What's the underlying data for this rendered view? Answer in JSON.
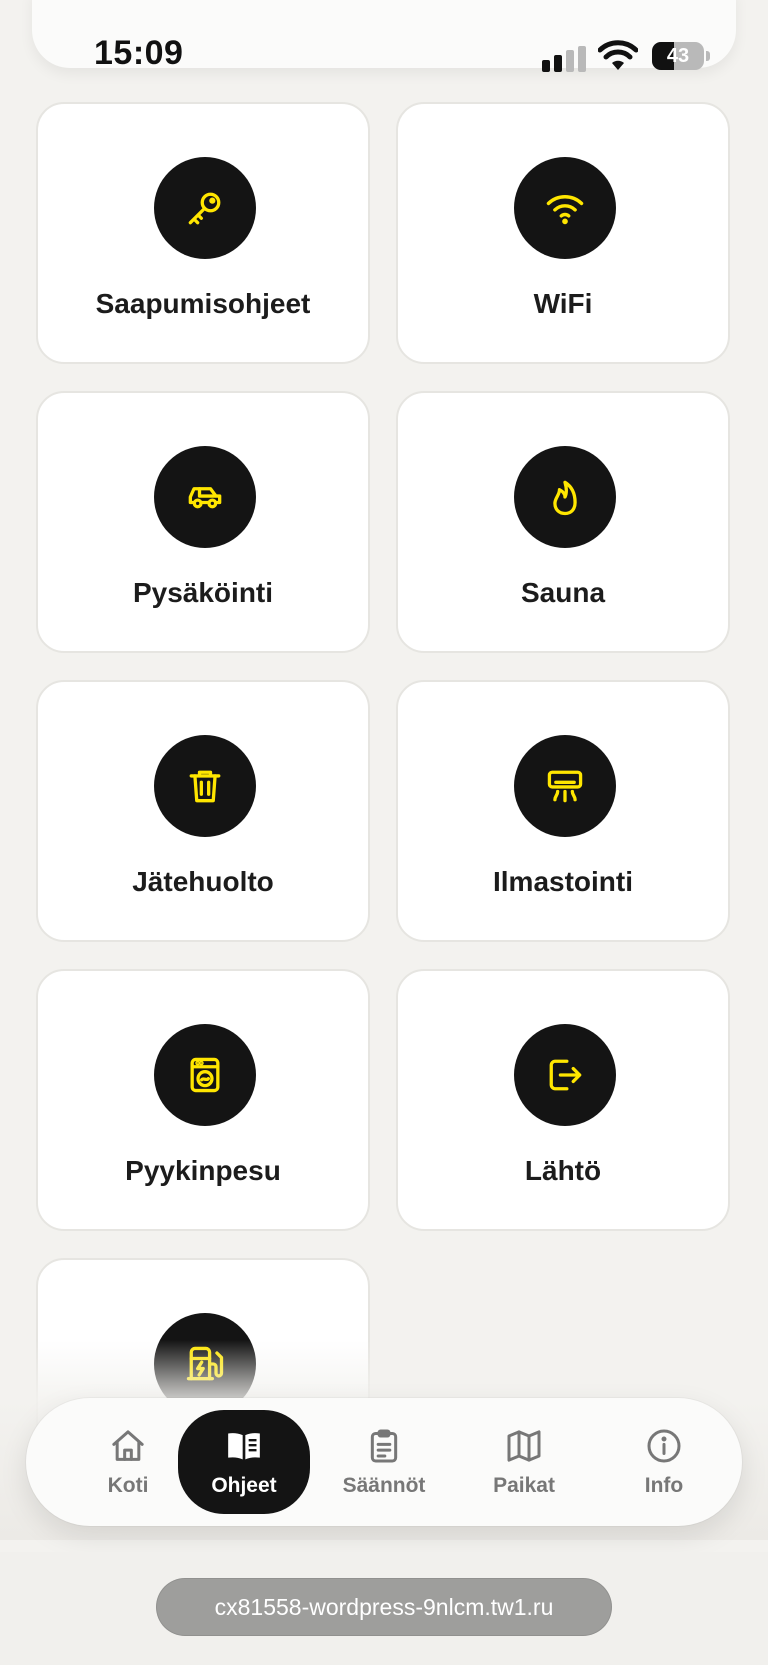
{
  "status_bar": {
    "time": "15:09",
    "battery_percent": 43
  },
  "colors": {
    "accent": "#FFE600",
    "icon_circle": "#141414",
    "card": "#FFFFFF",
    "background": "#F3F2EF"
  },
  "guides": [
    {
      "label": "Saapumisohjeet",
      "icon": "key-icon"
    },
    {
      "label": "WiFi",
      "icon": "wifi-icon"
    },
    {
      "label": "Pysäköinti",
      "icon": "car-icon"
    },
    {
      "label": "Sauna",
      "icon": "flame-icon"
    },
    {
      "label": "Jätehuolto",
      "icon": "trash-icon"
    },
    {
      "label": "Ilmastointi",
      "icon": "air-conditioner-icon"
    },
    {
      "label": "Pyykinpesu",
      "icon": "washing-machine-icon"
    },
    {
      "label": "Lähtö",
      "icon": "exit-icon"
    },
    {
      "label": "",
      "icon": "ev-charging-icon"
    }
  ],
  "tabs": [
    {
      "label": "Koti",
      "icon": "home-icon",
      "active": false
    },
    {
      "label": "Ohjeet",
      "icon": "book-icon",
      "active": true
    },
    {
      "label": "Säännöt",
      "icon": "clipboard-icon",
      "active": false
    },
    {
      "label": "Paikat",
      "icon": "map-icon",
      "active": false
    },
    {
      "label": "Info",
      "icon": "info-icon",
      "active": false
    }
  ],
  "browser": {
    "url": "cx81558-wordpress-9nlcm.tw1.ru"
  }
}
